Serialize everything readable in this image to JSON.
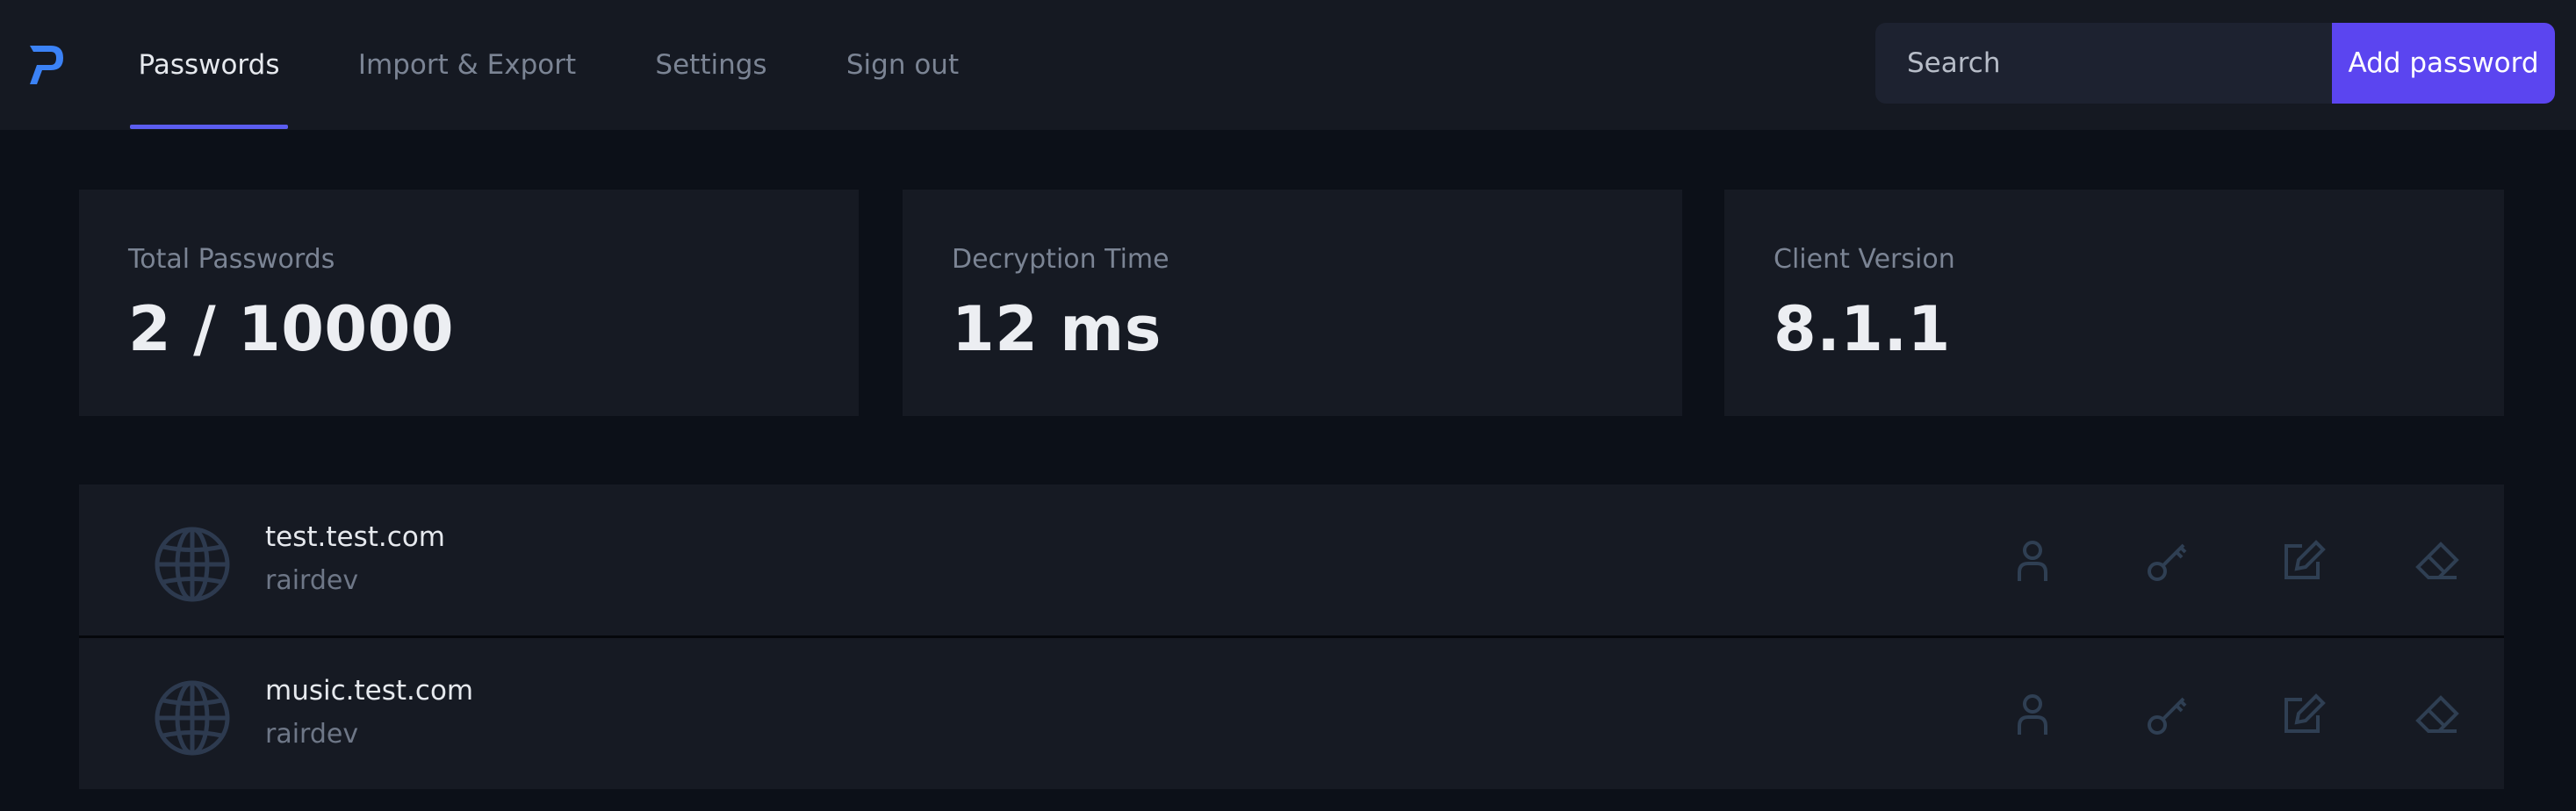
{
  "app": {
    "logo_icon": "brand-logo-icon",
    "accent_color": "#5b5df0"
  },
  "nav": {
    "tabs": [
      {
        "label": "Passwords",
        "active": true
      },
      {
        "label": "Import & Export",
        "active": false
      },
      {
        "label": "Settings",
        "active": false
      },
      {
        "label": "Sign out",
        "active": false
      }
    ]
  },
  "search": {
    "placeholder": "Search",
    "value": ""
  },
  "toolbar": {
    "add_label": "Add password",
    "add_color": "#5b45f0"
  },
  "stats": [
    {
      "label": "Total Passwords",
      "value": "2 / 10000"
    },
    {
      "label": "Decryption Time",
      "value": "12 ms"
    },
    {
      "label": "Client Version",
      "value": "8.1.1"
    }
  ],
  "passwords": [
    {
      "icon": "globe-icon",
      "website": "test.test.com",
      "username": "rairdev",
      "actions": [
        "copy-username-icon",
        "copy-password-icon",
        "edit-icon",
        "delete-icon"
      ]
    },
    {
      "icon": "globe-icon",
      "website": "music.test.com",
      "username": "rairdev",
      "actions": [
        "copy-username-icon",
        "copy-password-icon",
        "edit-icon",
        "delete-icon"
      ]
    }
  ]
}
